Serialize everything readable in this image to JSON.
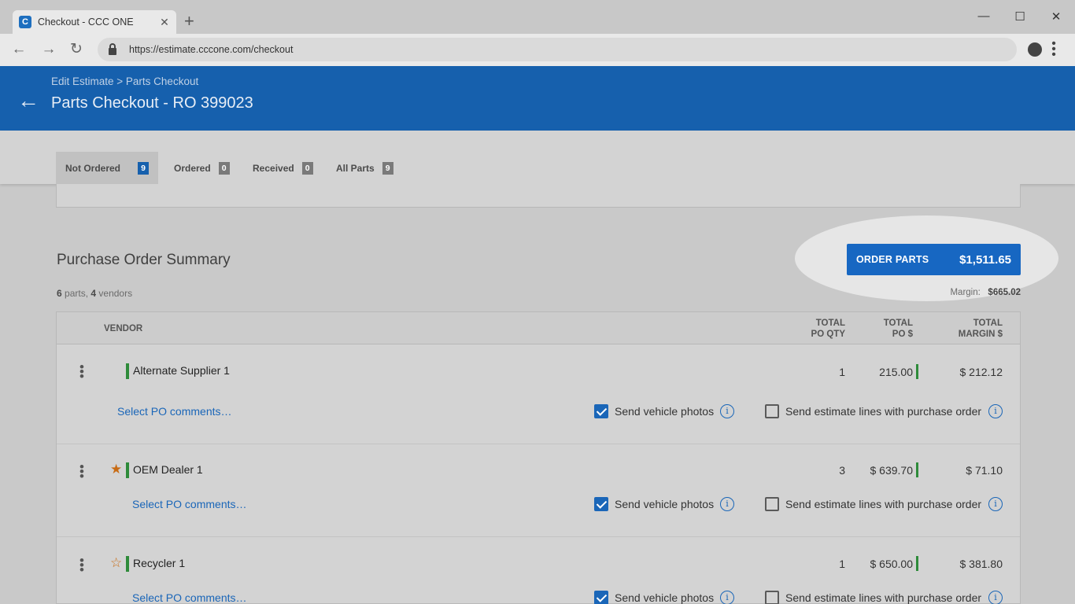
{
  "browser": {
    "tab_title": "Checkout - CCC ONE",
    "favicon": "C",
    "tab_close": "✕",
    "new_tab": "+",
    "url": "https://estimate.cccone.com/checkout",
    "icons": [
      "back-arrow-icon",
      "forward-arrow-icon",
      "reload-icon",
      "lock-icon",
      "profile-icon",
      "menu-icon"
    ]
  },
  "header": {
    "breadcrumb": "Edit Estimate > Parts Checkout",
    "title": "Parts Checkout - RO 399023",
    "color": "#1660ad"
  },
  "status_tabs": [
    {
      "label": "Not Ordered",
      "count": "9",
      "active": true
    },
    {
      "label": "Ordered",
      "count": "0",
      "active": false
    },
    {
      "label": "Received",
      "count": "0",
      "active": false
    },
    {
      "label": "All Parts",
      "count": "9",
      "active": false
    }
  ],
  "summary": {
    "title": "Purchase Order Summary",
    "parts_count": "6",
    "parts_word": " parts, ",
    "vendors_count": "4",
    "vendors_word": " vendors",
    "order_button_label": "ORDER PARTS",
    "order_total": "$1,511.65",
    "margin_label": "Margin:",
    "margin_value": "$665.02"
  },
  "table": {
    "headers": {
      "vendor": "VENDOR",
      "qty_line1": "TOTAL",
      "qty_line2": "PO QTY",
      "po_line1": "TOTAL",
      "po_line2": "PO $",
      "margin_line1": "TOTAL",
      "margin_line2": "MARGIN $"
    },
    "rows": [
      {
        "vendor": "Alternate Supplier 1",
        "star": "none",
        "qty": "1",
        "po_total": "215.00",
        "margin": "$ 212.12",
        "comment_link": "Select PO comments…",
        "send_photos": true,
        "photos_label": "Send vehicle photos",
        "send_lines": false,
        "lines_label": "Send estimate lines with purchase order"
      },
      {
        "vendor": "OEM Dealer 1",
        "star": "★",
        "qty": "3",
        "po_total": "$ 639.70",
        "margin": "$ 71.10",
        "comment_link": "Select PO comments…",
        "send_photos": true,
        "photos_label": "Send vehicle photos",
        "send_lines": false,
        "lines_label": "Send estimate lines with purchase order"
      },
      {
        "vendor": "Recycler 1",
        "star": "☆",
        "qty": "1",
        "po_total": "$ 650.00",
        "margin": "$ 381.80",
        "comment_link": "Select PO comments…",
        "send_photos": true,
        "photos_label": "Send vehicle photos",
        "send_lines": false,
        "lines_label": "Send estimate lines with purchase order"
      }
    ],
    "info_glyph": "i",
    "kebab_glyph": "⋮"
  }
}
